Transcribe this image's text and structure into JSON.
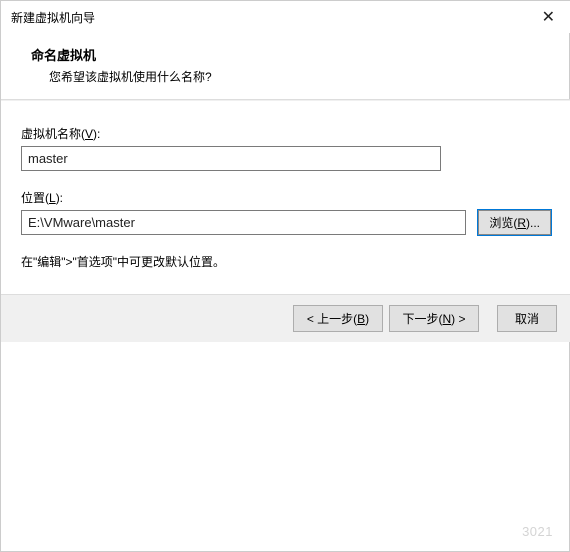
{
  "titlebar": {
    "title": "新建虚拟机向导"
  },
  "header": {
    "title": "命名虚拟机",
    "subtitle": "您希望该虚拟机使用什么名称?"
  },
  "fields": {
    "name_label_prefix": "虚拟机名称(",
    "name_label_key": "V",
    "name_label_suffix": "):",
    "name_value": "master",
    "location_label_prefix": "位置(",
    "location_label_key": "L",
    "location_label_suffix": "):",
    "location_value": "E:\\VMware\\master",
    "browse_prefix": "浏览(",
    "browse_key": "R",
    "browse_suffix": ")..."
  },
  "hint": "在\"编辑\">\"首选项\"中可更改默认位置。",
  "footer": {
    "back_prefix": "< 上一步(",
    "back_key": "B",
    "back_suffix": ")",
    "next_prefix": "下一步(",
    "next_key": "N",
    "next_suffix": ") >",
    "cancel": "取消"
  },
  "watermark": "3021"
}
